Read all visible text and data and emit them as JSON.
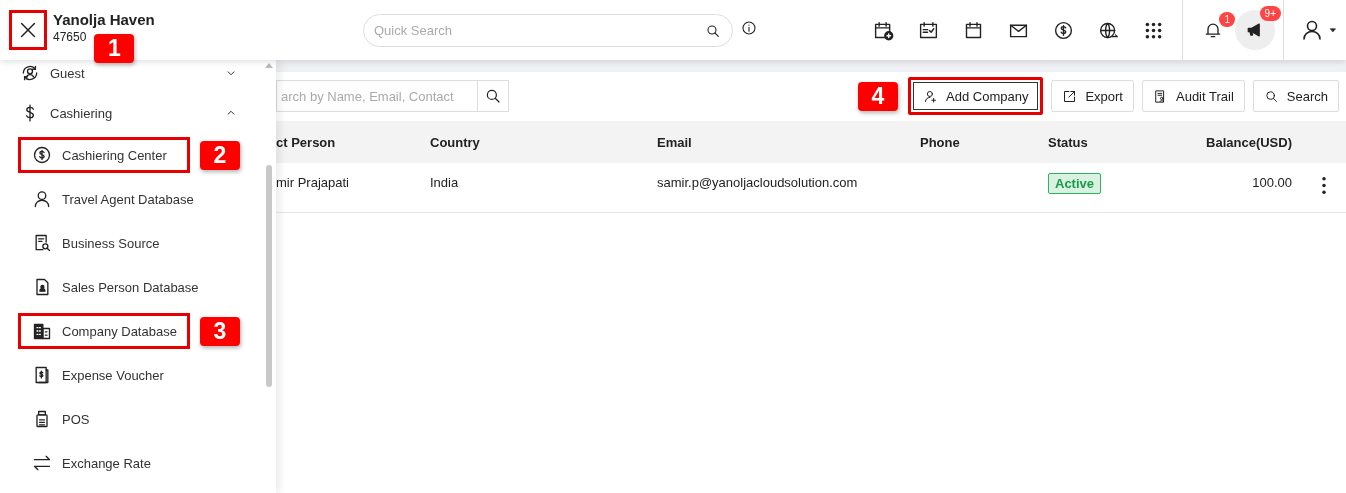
{
  "header": {
    "close_highlighted": true,
    "close_callout": "1",
    "property_name": "Yanolja Haven",
    "property_id": "47650",
    "quick_search": {
      "placeholder": "Quick Search"
    },
    "notifications_badge": "1",
    "announcements_badge": "9+"
  },
  "sidebar": {
    "groups": [
      {
        "label": "Guest",
        "expanded": false
      },
      {
        "label": "Cashiering",
        "expanded": true,
        "children": [
          {
            "label": "Cashiering Center",
            "highlighted": true,
            "callout": "2"
          },
          {
            "label": "Travel Agent Database",
            "highlighted": false
          },
          {
            "label": "Business Source",
            "highlighted": false
          },
          {
            "label": "Sales Person Database",
            "highlighted": false
          },
          {
            "label": "Company Database",
            "highlighted": true,
            "callout": "3"
          },
          {
            "label": "Expense Voucher",
            "highlighted": false
          },
          {
            "label": "POS",
            "highlighted": false
          },
          {
            "label": "Exchange Rate",
            "highlighted": false
          }
        ]
      }
    ]
  },
  "toolbar": {
    "search": {
      "placeholder": "arch by Name, Email, Contact"
    },
    "buttons": [
      {
        "label": "Add Company",
        "highlighted": true,
        "callout": "4"
      },
      {
        "label": "Export",
        "highlighted": false
      },
      {
        "label": "Audit Trail",
        "highlighted": false
      },
      {
        "label": "Search",
        "highlighted": false
      }
    ]
  },
  "table": {
    "columns": [
      "ct Person",
      "Country",
      "Email",
      "Phone",
      "Status",
      "Balance(USD)"
    ],
    "rows": [
      {
        "contact_person": "mir Prajapati",
        "country": "India",
        "email": "samir.p@yanoljacloudsolution.com",
        "status": "Active",
        "balance": "100.00"
      }
    ]
  }
}
